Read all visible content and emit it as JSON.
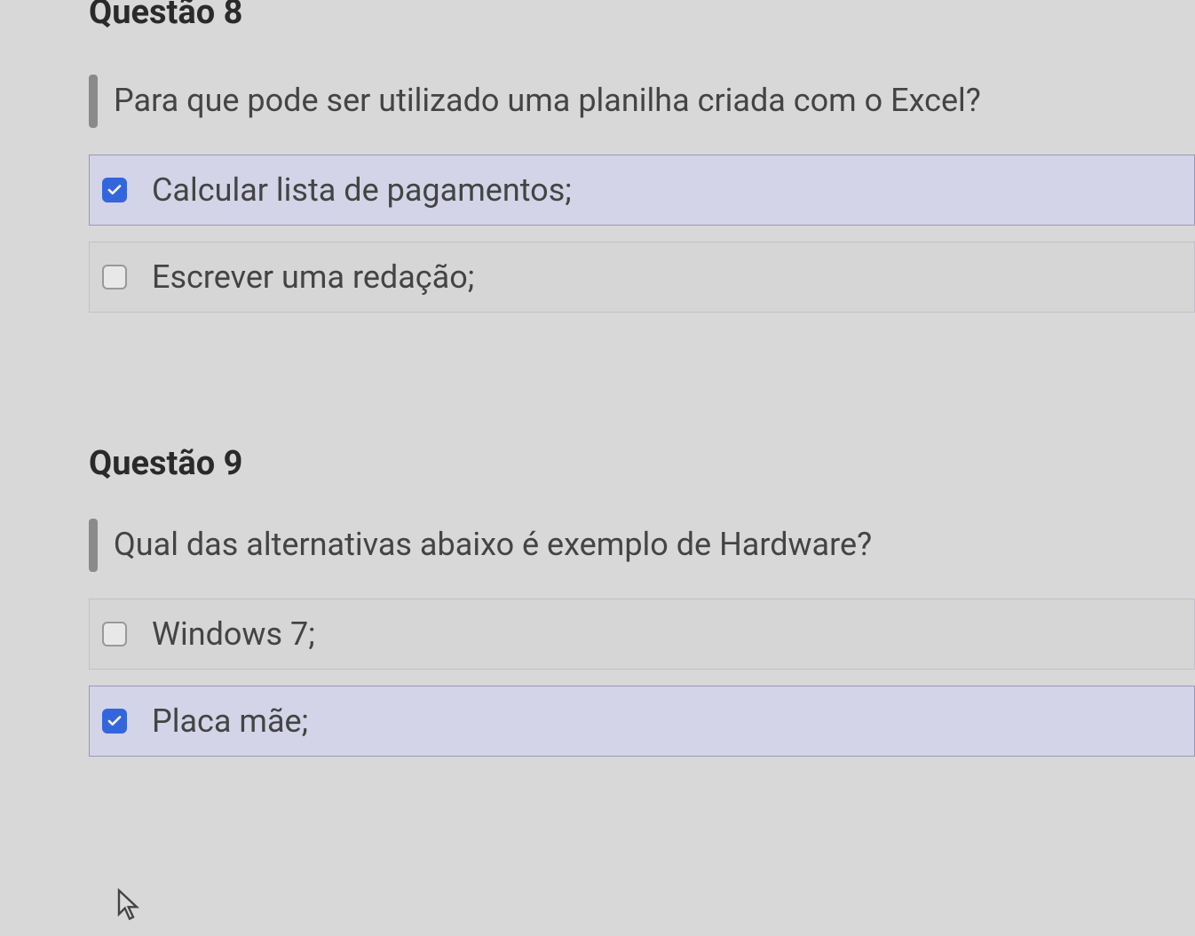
{
  "questions": {
    "q8": {
      "title": "Questão 8",
      "prompt": "Para que pode ser utilizado uma planilha criada com o Excel?",
      "options": [
        {
          "label": "Calcular lista de pagamentos;",
          "checked": true
        },
        {
          "label": "Escrever uma redação;",
          "checked": false
        }
      ]
    },
    "q9": {
      "title": "Questão 9",
      "prompt": "Qual das alternativas abaixo é exemplo de Hardware?",
      "options": [
        {
          "label": "Windows 7;",
          "checked": false
        },
        {
          "label": "Placa mãe;",
          "checked": true
        }
      ]
    }
  },
  "colors": {
    "checkbox_checked_bg": "#3366dd",
    "selected_row_bg": "#d4d4e8",
    "page_bg": "#d8d8d8"
  }
}
